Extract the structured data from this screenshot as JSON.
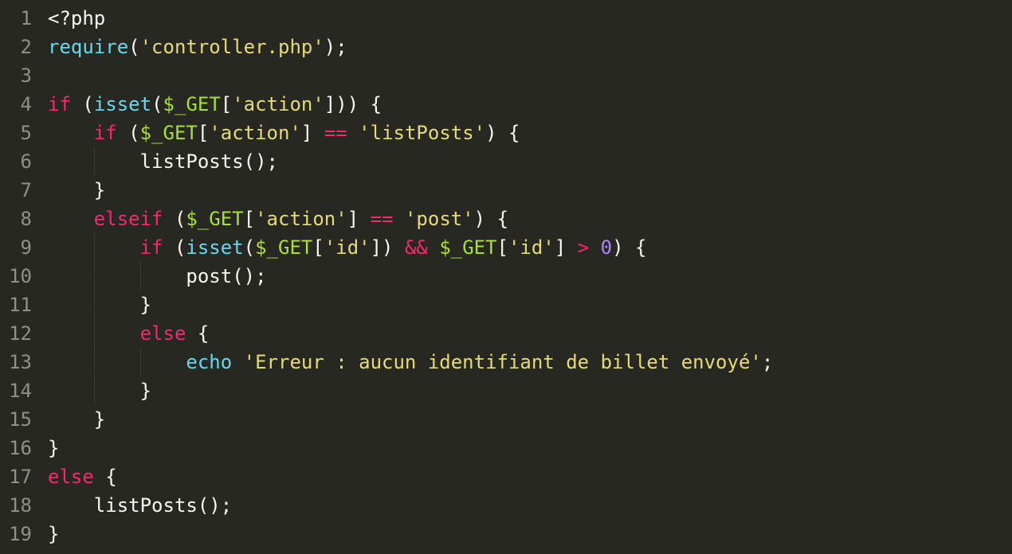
{
  "editor": {
    "background": "#272822",
    "colors": {
      "plain": "#f8f8f2",
      "keyword": "#f92672",
      "function": "#66d9ef",
      "string": "#e6db74",
      "variable": "#a6e22e",
      "number": "#ae81ff",
      "line_number": "#90908a"
    },
    "lines": [
      {
        "n": "1",
        "indent": 0,
        "tokens": [
          {
            "t": "plain",
            "v": "<?php"
          }
        ]
      },
      {
        "n": "2",
        "indent": 0,
        "tokens": [
          {
            "t": "fn",
            "v": "require"
          },
          {
            "t": "plain",
            "v": "("
          },
          {
            "t": "str",
            "v": "'controller.php'"
          },
          {
            "t": "plain",
            "v": ");"
          }
        ]
      },
      {
        "n": "3",
        "indent": 0,
        "tokens": []
      },
      {
        "n": "4",
        "indent": 0,
        "tokens": [
          {
            "t": "kw",
            "v": "if"
          },
          {
            "t": "plain",
            "v": " ("
          },
          {
            "t": "fn",
            "v": "isset"
          },
          {
            "t": "plain",
            "v": "("
          },
          {
            "t": "var",
            "v": "$_GET"
          },
          {
            "t": "plain",
            "v": "["
          },
          {
            "t": "str",
            "v": "'action'"
          },
          {
            "t": "plain",
            "v": "])) {"
          }
        ]
      },
      {
        "n": "5",
        "indent": 1,
        "tokens": [
          {
            "t": "kw",
            "v": "if"
          },
          {
            "t": "plain",
            "v": " ("
          },
          {
            "t": "var",
            "v": "$_GET"
          },
          {
            "t": "plain",
            "v": "["
          },
          {
            "t": "str",
            "v": "'action'"
          },
          {
            "t": "plain",
            "v": "] "
          },
          {
            "t": "op",
            "v": "=="
          },
          {
            "t": "plain",
            "v": " "
          },
          {
            "t": "str",
            "v": "'listPosts'"
          },
          {
            "t": "plain",
            "v": ") {"
          }
        ]
      },
      {
        "n": "6",
        "indent": 2,
        "tokens": [
          {
            "t": "plain",
            "v": "listPosts();"
          }
        ]
      },
      {
        "n": "7",
        "indent": 1,
        "tokens": [
          {
            "t": "plain",
            "v": "}"
          }
        ]
      },
      {
        "n": "8",
        "indent": 1,
        "tokens": [
          {
            "t": "kw",
            "v": "elseif"
          },
          {
            "t": "plain",
            "v": " ("
          },
          {
            "t": "var",
            "v": "$_GET"
          },
          {
            "t": "plain",
            "v": "["
          },
          {
            "t": "str",
            "v": "'action'"
          },
          {
            "t": "plain",
            "v": "] "
          },
          {
            "t": "op",
            "v": "=="
          },
          {
            "t": "plain",
            "v": " "
          },
          {
            "t": "str",
            "v": "'post'"
          },
          {
            "t": "plain",
            "v": ") {"
          }
        ]
      },
      {
        "n": "9",
        "indent": 2,
        "tokens": [
          {
            "t": "kw",
            "v": "if"
          },
          {
            "t": "plain",
            "v": " ("
          },
          {
            "t": "fn",
            "v": "isset"
          },
          {
            "t": "plain",
            "v": "("
          },
          {
            "t": "var",
            "v": "$_GET"
          },
          {
            "t": "plain",
            "v": "["
          },
          {
            "t": "str",
            "v": "'id'"
          },
          {
            "t": "plain",
            "v": "]) "
          },
          {
            "t": "op",
            "v": "&&"
          },
          {
            "t": "plain",
            "v": " "
          },
          {
            "t": "var",
            "v": "$_GET"
          },
          {
            "t": "plain",
            "v": "["
          },
          {
            "t": "str",
            "v": "'id'"
          },
          {
            "t": "plain",
            "v": "] "
          },
          {
            "t": "op",
            "v": ">"
          },
          {
            "t": "plain",
            "v": " "
          },
          {
            "t": "num",
            "v": "0"
          },
          {
            "t": "plain",
            "v": ") {"
          }
        ]
      },
      {
        "n": "10",
        "indent": 3,
        "tokens": [
          {
            "t": "plain",
            "v": "post();"
          }
        ]
      },
      {
        "n": "11",
        "indent": 2,
        "tokens": [
          {
            "t": "plain",
            "v": "}"
          }
        ]
      },
      {
        "n": "12",
        "indent": 2,
        "tokens": [
          {
            "t": "kw",
            "v": "else"
          },
          {
            "t": "plain",
            "v": " {"
          }
        ]
      },
      {
        "n": "13",
        "indent": 3,
        "tokens": [
          {
            "t": "fn",
            "v": "echo"
          },
          {
            "t": "plain",
            "v": " "
          },
          {
            "t": "str",
            "v": "'Erreur : aucun identifiant de billet envoyé'"
          },
          {
            "t": "plain",
            "v": ";"
          }
        ]
      },
      {
        "n": "14",
        "indent": 2,
        "tokens": [
          {
            "t": "plain",
            "v": "}"
          }
        ]
      },
      {
        "n": "15",
        "indent": 1,
        "tokens": [
          {
            "t": "plain",
            "v": "}"
          }
        ]
      },
      {
        "n": "16",
        "indent": 0,
        "tokens": [
          {
            "t": "plain",
            "v": "}"
          }
        ]
      },
      {
        "n": "17",
        "indent": 0,
        "tokens": [
          {
            "t": "kw",
            "v": "else"
          },
          {
            "t": "plain",
            "v": " {"
          }
        ]
      },
      {
        "n": "18",
        "indent": 1,
        "tokens": [
          {
            "t": "plain",
            "v": "listPosts();"
          }
        ]
      },
      {
        "n": "19",
        "indent": 0,
        "tokens": [
          {
            "t": "plain",
            "v": "}"
          }
        ]
      }
    ]
  }
}
